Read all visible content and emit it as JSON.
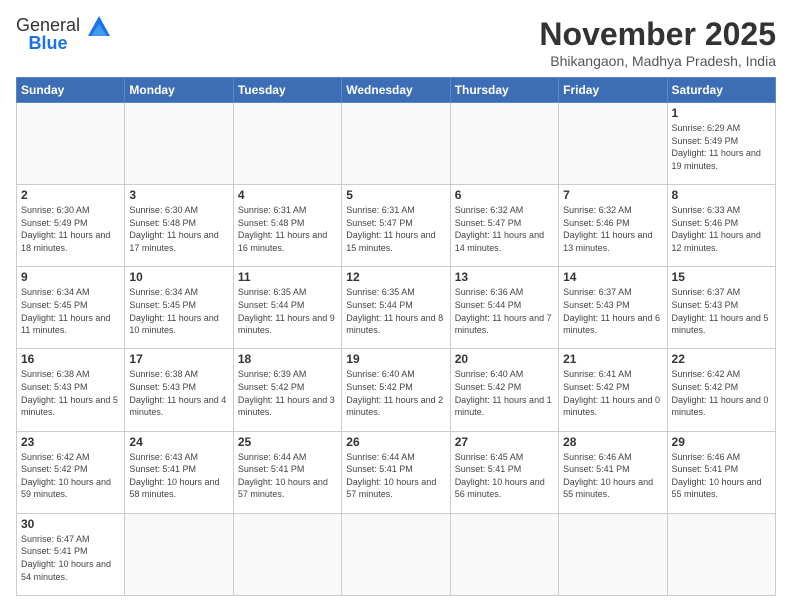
{
  "header": {
    "logo_general": "General",
    "logo_blue": "Blue",
    "title": "November 2025",
    "subtitle": "Bhikangaon, Madhya Pradesh, India"
  },
  "weekdays": [
    "Sunday",
    "Monday",
    "Tuesday",
    "Wednesday",
    "Thursday",
    "Friday",
    "Saturday"
  ],
  "weeks": [
    [
      {
        "day": "",
        "info": ""
      },
      {
        "day": "",
        "info": ""
      },
      {
        "day": "",
        "info": ""
      },
      {
        "day": "",
        "info": ""
      },
      {
        "day": "",
        "info": ""
      },
      {
        "day": "",
        "info": ""
      },
      {
        "day": "1",
        "info": "Sunrise: 6:29 AM\nSunset: 5:49 PM\nDaylight: 11 hours and 19 minutes."
      }
    ],
    [
      {
        "day": "2",
        "info": "Sunrise: 6:30 AM\nSunset: 5:49 PM\nDaylight: 11 hours and 18 minutes."
      },
      {
        "day": "3",
        "info": "Sunrise: 6:30 AM\nSunset: 5:48 PM\nDaylight: 11 hours and 17 minutes."
      },
      {
        "day": "4",
        "info": "Sunrise: 6:31 AM\nSunset: 5:48 PM\nDaylight: 11 hours and 16 minutes."
      },
      {
        "day": "5",
        "info": "Sunrise: 6:31 AM\nSunset: 5:47 PM\nDaylight: 11 hours and 15 minutes."
      },
      {
        "day": "6",
        "info": "Sunrise: 6:32 AM\nSunset: 5:47 PM\nDaylight: 11 hours and 14 minutes."
      },
      {
        "day": "7",
        "info": "Sunrise: 6:32 AM\nSunset: 5:46 PM\nDaylight: 11 hours and 13 minutes."
      },
      {
        "day": "8",
        "info": "Sunrise: 6:33 AM\nSunset: 5:46 PM\nDaylight: 11 hours and 12 minutes."
      }
    ],
    [
      {
        "day": "9",
        "info": "Sunrise: 6:34 AM\nSunset: 5:45 PM\nDaylight: 11 hours and 11 minutes."
      },
      {
        "day": "10",
        "info": "Sunrise: 6:34 AM\nSunset: 5:45 PM\nDaylight: 11 hours and 10 minutes."
      },
      {
        "day": "11",
        "info": "Sunrise: 6:35 AM\nSunset: 5:44 PM\nDaylight: 11 hours and 9 minutes."
      },
      {
        "day": "12",
        "info": "Sunrise: 6:35 AM\nSunset: 5:44 PM\nDaylight: 11 hours and 8 minutes."
      },
      {
        "day": "13",
        "info": "Sunrise: 6:36 AM\nSunset: 5:44 PM\nDaylight: 11 hours and 7 minutes."
      },
      {
        "day": "14",
        "info": "Sunrise: 6:37 AM\nSunset: 5:43 PM\nDaylight: 11 hours and 6 minutes."
      },
      {
        "day": "15",
        "info": "Sunrise: 6:37 AM\nSunset: 5:43 PM\nDaylight: 11 hours and 5 minutes."
      }
    ],
    [
      {
        "day": "16",
        "info": "Sunrise: 6:38 AM\nSunset: 5:43 PM\nDaylight: 11 hours and 5 minutes."
      },
      {
        "day": "17",
        "info": "Sunrise: 6:38 AM\nSunset: 5:43 PM\nDaylight: 11 hours and 4 minutes."
      },
      {
        "day": "18",
        "info": "Sunrise: 6:39 AM\nSunset: 5:42 PM\nDaylight: 11 hours and 3 minutes."
      },
      {
        "day": "19",
        "info": "Sunrise: 6:40 AM\nSunset: 5:42 PM\nDaylight: 11 hours and 2 minutes."
      },
      {
        "day": "20",
        "info": "Sunrise: 6:40 AM\nSunset: 5:42 PM\nDaylight: 11 hours and 1 minute."
      },
      {
        "day": "21",
        "info": "Sunrise: 6:41 AM\nSunset: 5:42 PM\nDaylight: 11 hours and 0 minutes."
      },
      {
        "day": "22",
        "info": "Sunrise: 6:42 AM\nSunset: 5:42 PM\nDaylight: 11 hours and 0 minutes."
      }
    ],
    [
      {
        "day": "23",
        "info": "Sunrise: 6:42 AM\nSunset: 5:42 PM\nDaylight: 10 hours and 59 minutes."
      },
      {
        "day": "24",
        "info": "Sunrise: 6:43 AM\nSunset: 5:41 PM\nDaylight: 10 hours and 58 minutes."
      },
      {
        "day": "25",
        "info": "Sunrise: 6:44 AM\nSunset: 5:41 PM\nDaylight: 10 hours and 57 minutes."
      },
      {
        "day": "26",
        "info": "Sunrise: 6:44 AM\nSunset: 5:41 PM\nDaylight: 10 hours and 57 minutes."
      },
      {
        "day": "27",
        "info": "Sunrise: 6:45 AM\nSunset: 5:41 PM\nDaylight: 10 hours and 56 minutes."
      },
      {
        "day": "28",
        "info": "Sunrise: 6:46 AM\nSunset: 5:41 PM\nDaylight: 10 hours and 55 minutes."
      },
      {
        "day": "29",
        "info": "Sunrise: 6:46 AM\nSunset: 5:41 PM\nDaylight: 10 hours and 55 minutes."
      }
    ],
    [
      {
        "day": "30",
        "info": "Sunrise: 6:47 AM\nSunset: 5:41 PM\nDaylight: 10 hours and 54 minutes."
      },
      {
        "day": "",
        "info": ""
      },
      {
        "day": "",
        "info": ""
      },
      {
        "day": "",
        "info": ""
      },
      {
        "day": "",
        "info": ""
      },
      {
        "day": "",
        "info": ""
      },
      {
        "day": "",
        "info": ""
      }
    ]
  ]
}
